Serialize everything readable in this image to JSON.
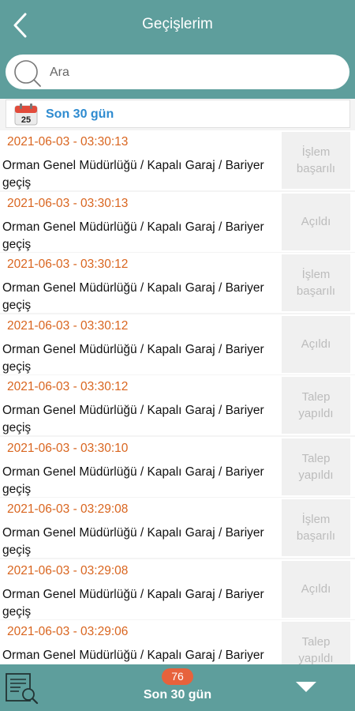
{
  "header": {
    "title": "Geçişlerim",
    "back_icon": "chevron-left-icon"
  },
  "search": {
    "placeholder": "Ara",
    "value": "",
    "icon": "search-icon"
  },
  "filter": {
    "icon": "calendar-icon",
    "calendar_day": "25",
    "label": "Son 30 gün"
  },
  "passes": [
    {
      "datetime": "2021-06-03 - 03:30:13",
      "location": "Orman Genel Müdürlüğü / Kapalı Garaj / Bariyer geçiş",
      "status": "İşlem başarılı"
    },
    {
      "datetime": "2021-06-03 - 03:30:13",
      "location": "Orman Genel Müdürlüğü / Kapalı Garaj / Bariyer geçiş",
      "status": "Açıldı"
    },
    {
      "datetime": "2021-06-03 - 03:30:12",
      "location": "Orman Genel Müdürlüğü / Kapalı Garaj / Bariyer geçiş",
      "status": "İşlem başarılı"
    },
    {
      "datetime": "2021-06-03 - 03:30:12",
      "location": "Orman Genel Müdürlüğü / Kapalı Garaj / Bariyer geçiş",
      "status": "Açıldı"
    },
    {
      "datetime": "2021-06-03 - 03:30:12",
      "location": "Orman Genel Müdürlüğü / Kapalı Garaj / Bariyer geçiş",
      "status": "Talep yapıldı"
    },
    {
      "datetime": "2021-06-03 - 03:30:10",
      "location": "Orman Genel Müdürlüğü / Kapalı Garaj / Bariyer geçiş",
      "status": "Talep yapıldı"
    },
    {
      "datetime": "2021-06-03 - 03:29:08",
      "location": "Orman Genel Müdürlüğü / Kapalı Garaj / Bariyer geçiş",
      "status": "İşlem başarılı"
    },
    {
      "datetime": "2021-06-03 - 03:29:08",
      "location": "Orman Genel Müdürlüğü / Kapalı Garaj / Bariyer geçiş",
      "status": "Açıldı"
    },
    {
      "datetime": "2021-06-03 - 03:29:06",
      "location": "Orman Genel Müdürlüğü / Kapalı Garaj / Bariyer geçiş",
      "status": "Talep yapıldı"
    }
  ],
  "footer": {
    "report_icon": "report-search-icon",
    "count": "76",
    "label": "Son 30 gün",
    "dropdown_icon": "caret-down-icon"
  },
  "colors": {
    "primary": "#5e9e9c",
    "date_text": "#d9651f",
    "filter_text": "#2e8bd0",
    "status_text": "#bcbcbc",
    "badge": "#e7623c"
  }
}
